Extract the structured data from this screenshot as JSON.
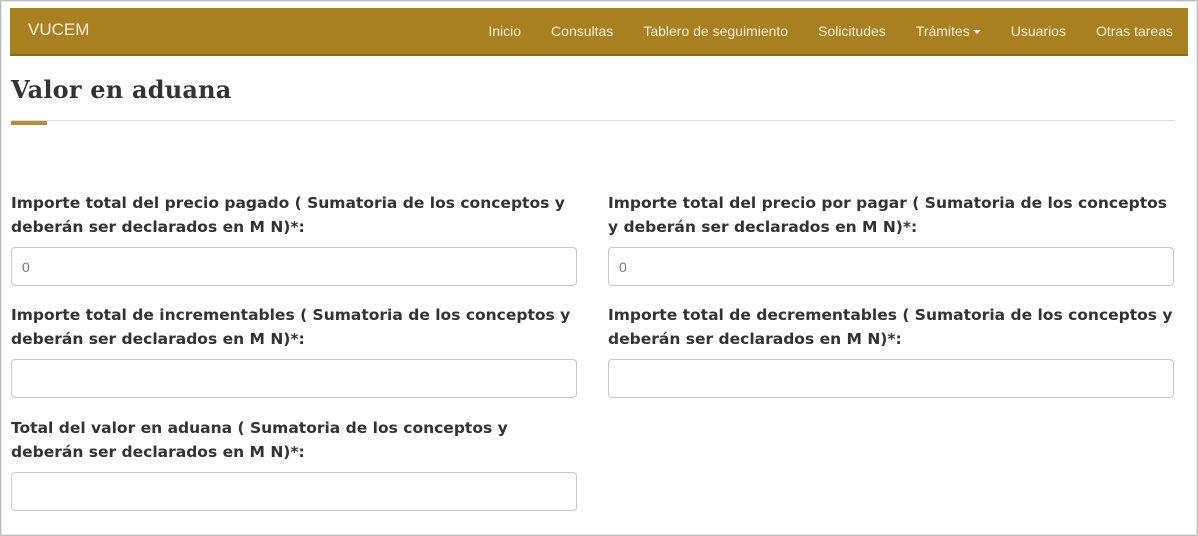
{
  "navbar": {
    "brand": "VUCEM",
    "items": [
      {
        "label": "Inicio"
      },
      {
        "label": "Consultas"
      },
      {
        "label": "Tablero de seguimiento"
      },
      {
        "label": "Solicitudes"
      },
      {
        "label": "Trámites",
        "dropdown": true
      },
      {
        "label": "Usuarios"
      },
      {
        "label": "Otras tareas"
      }
    ],
    "color": "#a8801f"
  },
  "page": {
    "title": "Valor en aduana",
    "accent_color": "#b38d3c"
  },
  "form": {
    "fields": [
      {
        "label": "Importe total del precio pagado ( Sumatoria de los conceptos y deberán ser declarados en M N)*:",
        "value": "0"
      },
      {
        "label": "Importe total del precio por pagar ( Sumatoria de los conceptos y deberán ser declarados en M N)*:",
        "value": "0"
      },
      {
        "label": "Importe total de incrementables ( Sumatoria de los conceptos y deberán ser declarados en M N)*:",
        "value": ""
      },
      {
        "label": "Importe total de decrementables ( Sumatoria de los conceptos y deberán ser declarados en M N)*:",
        "value": ""
      },
      {
        "label": "Total del valor en aduana ( Sumatoria de los conceptos y deberán ser declarados en M N)*:",
        "value": ""
      }
    ]
  }
}
